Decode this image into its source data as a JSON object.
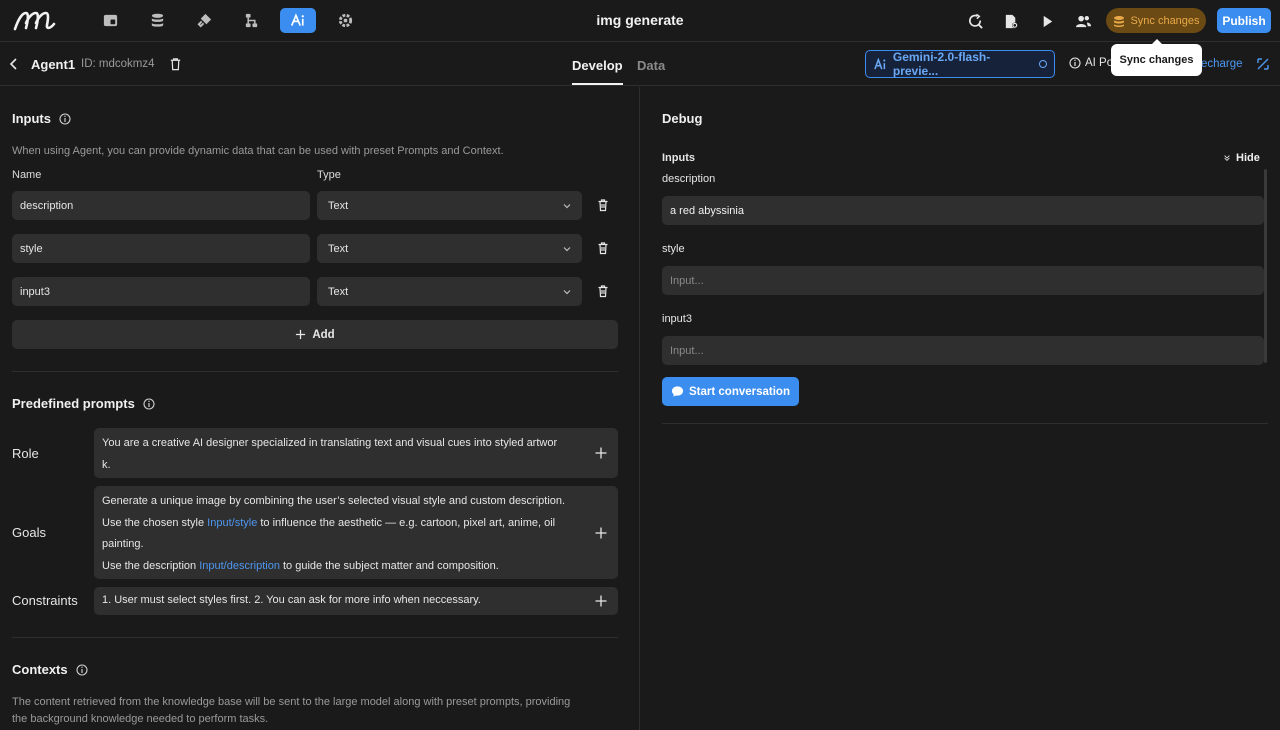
{
  "app": {
    "title": "img generate",
    "sync_label": "Sync changes",
    "publish_label": "Publish",
    "tooltip": "Sync changes"
  },
  "agent": {
    "name": "Agent1",
    "id": "ID: mdcokmz4"
  },
  "tabs": [
    {
      "label": "Develop",
      "active": true
    },
    {
      "label": "Data",
      "active": false
    }
  ],
  "model": {
    "label": "Gemini-2.0-flash-previe..."
  },
  "ai_points": "AI Po",
  "recharge": "echarge",
  "inputs": {
    "title": "Inputs",
    "description": "When using Agent, you can provide dynamic data that can be used with preset Prompts and Context.",
    "col_name": "Name",
    "col_type": "Type",
    "rows": [
      {
        "name": "description",
        "type": "Text"
      },
      {
        "name": "style",
        "type": "Text"
      },
      {
        "name": "input3",
        "type": "Text"
      }
    ],
    "add_label": "Add"
  },
  "prompts": {
    "title": "Predefined prompts",
    "role_label": "Role",
    "role_line1": "You are a creative AI designer specialized in translating text and visual cues into styled artwor",
    "role_line2": "k.",
    "goals_label": "Goals",
    "goals_line1": "Generate a unique image by combining the user’s selected visual style and custom description.",
    "goals_line2_a": "Use the chosen style ",
    "goals_line2_link": "Input/style",
    "goals_line2_b": " to influence the aesthetic — e.g. cartoon, pixel art, anime, oil",
    "goals_line3": "painting.",
    "goals_line4_a": "Use the description ",
    "goals_line4_link": "Input/description",
    "goals_line4_b": " to guide the subject matter and composition.",
    "constraints_label": "Constraints",
    "constraints_text": "1. User must select styles first. 2. You can ask for more info when neccessary."
  },
  "contexts": {
    "title": "Contexts",
    "line1": "The content retrieved from the knowledge base will be sent to the large model along with preset prompts, providing",
    "line2": "the background knowledge needed to perform tasks."
  },
  "debug": {
    "title": "Debug",
    "inputs_title": "Inputs",
    "hide_label": "Hide",
    "fields": [
      {
        "label": "description",
        "value": "a red abyssinia",
        "placeholder": ""
      },
      {
        "label": "style",
        "value": "",
        "placeholder": "Input..."
      },
      {
        "label": "input3",
        "value": "",
        "placeholder": "Input..."
      }
    ],
    "start_label": "Start conversation"
  },
  "colors": {
    "accent": "#3b8ef0",
    "sync_bg": "#6b4a13",
    "sync_text": "#e9a94a",
    "link": "#4e97f0"
  },
  "icons": [
    "logo-icon",
    "files-icon",
    "database-icon",
    "plugin-icon",
    "workflow-icon",
    "ai-icon",
    "gear-icon",
    "refresh-search-icon",
    "document-gear-icon",
    "play-icon",
    "users-icon",
    "coins-icon",
    "chevron-left-icon",
    "trash-icon",
    "info-icon",
    "chevron-down-icon",
    "plus-icon",
    "collapse-icon",
    "chat-icon"
  ]
}
